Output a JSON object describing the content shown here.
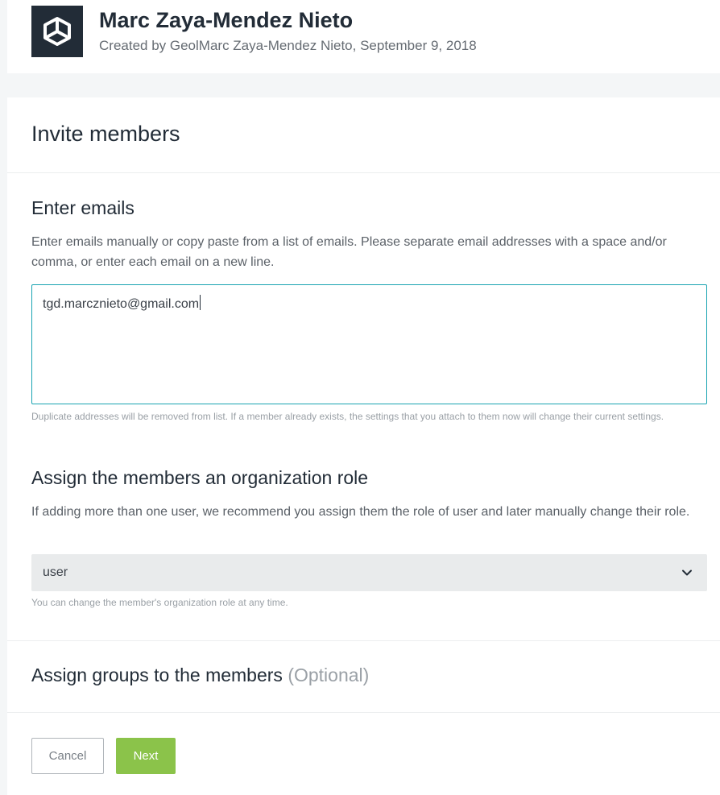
{
  "header": {
    "org_name": "Marc Zaya-Mendez Nieto",
    "org_meta": "Created by GeolMarc Zaya-Mendez Nieto, September 9, 2018",
    "logo_icon": "unity-logo-icon"
  },
  "invite": {
    "title": "Invite members",
    "emails": {
      "heading": "Enter emails",
      "description": "Enter emails manually or copy paste from a list of emails. Please separate email addresses with a space and/or comma, or enter each email on a new line.",
      "value": "tgd.marcznieto@gmail.com",
      "hint": "Duplicate addresses will be removed from list. If a member already exists, the settings that you attach to them now will change their current settings."
    },
    "role": {
      "heading": "Assign the members an organization role",
      "description": "If adding more than one user, we recommend you assign them the role of user and later manually change their role.",
      "selected": "user",
      "hint": "You can change the member's organization role at any time."
    },
    "groups": {
      "heading": "Assign groups to the members",
      "optional": "(Optional)"
    },
    "actions": {
      "cancel_label": "Cancel",
      "next_label": "Next"
    }
  },
  "colors": {
    "accent_focus": "#19a4b2",
    "primary_button": "#8bc34a",
    "logo_bg": "#222c37"
  }
}
